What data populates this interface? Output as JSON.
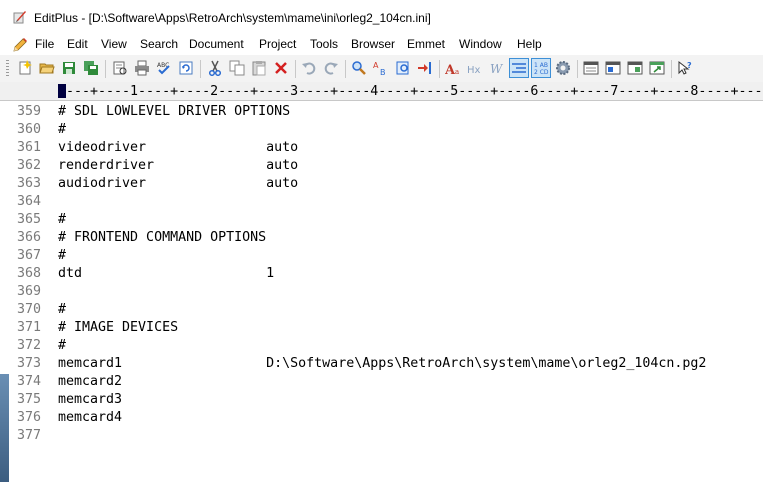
{
  "window": {
    "title": "EditPlus - [D:\\Software\\Apps\\RetroArch\\system\\mame\\ini\\orleg2_104cn.ini]"
  },
  "menu": {
    "items": [
      "File",
      "Edit",
      "View",
      "Search",
      "Document",
      "Project",
      "Tools",
      "Browser",
      "Emmet",
      "Window",
      "Help"
    ]
  },
  "toolbar": {
    "buttons": [
      {
        "icon": "new-file-icon"
      },
      {
        "icon": "open-folder-icon"
      },
      {
        "icon": "save-icon"
      },
      {
        "icon": "save-all-icon"
      },
      {
        "icon": "print-preview-icon"
      },
      {
        "icon": "print-icon"
      },
      {
        "icon": "spell-check-icon"
      },
      {
        "icon": "refresh-icon"
      },
      {
        "icon": "cut-icon"
      },
      {
        "icon": "copy-icon"
      },
      {
        "icon": "paste-icon"
      },
      {
        "icon": "delete-icon"
      },
      {
        "icon": "undo-icon"
      },
      {
        "icon": "redo-icon"
      },
      {
        "icon": "find-icon"
      },
      {
        "icon": "replace-icon"
      },
      {
        "icon": "find-in-files-icon"
      },
      {
        "icon": "goto-icon"
      },
      {
        "icon": "font-icon"
      },
      {
        "icon": "hex-icon"
      },
      {
        "icon": "word-wrap-icon"
      },
      {
        "icon": "line-numbers-icon"
      },
      {
        "icon": "ruler-icon"
      },
      {
        "icon": "settings-icon"
      },
      {
        "icon": "window-list-icon"
      },
      {
        "icon": "html-toolbar-icon"
      },
      {
        "icon": "cliptext-icon"
      },
      {
        "icon": "browser-icon"
      },
      {
        "icon": "help-icon"
      }
    ]
  },
  "ruler": {
    "text": "----+----1----+----2----+----3----+----4----+----5----+----6----+----7----+----8----+---"
  },
  "editor": {
    "lines": [
      {
        "num": "359",
        "text": "# SDL LOWLEVEL DRIVER OPTIONS"
      },
      {
        "num": "360",
        "text": "#"
      },
      {
        "num": "361",
        "text": "videodriver               auto"
      },
      {
        "num": "362",
        "text": "renderdriver              auto"
      },
      {
        "num": "363",
        "text": "audiodriver               auto"
      },
      {
        "num": "364",
        "text": ""
      },
      {
        "num": "365",
        "text": "#"
      },
      {
        "num": "366",
        "text": "# FRONTEND COMMAND OPTIONS"
      },
      {
        "num": "367",
        "text": "#"
      },
      {
        "num": "368",
        "text": "dtd                       1"
      },
      {
        "num": "369",
        "text": ""
      },
      {
        "num": "370",
        "text": "#"
      },
      {
        "num": "371",
        "text": "# IMAGE DEVICES"
      },
      {
        "num": "372",
        "text": "#"
      },
      {
        "num": "373",
        "text": "memcard1                  D:\\Software\\Apps\\RetroArch\\system\\mame\\orleg2_104cn.pg2"
      },
      {
        "num": "374",
        "text": "memcard2"
      },
      {
        "num": "375",
        "text": "memcard3"
      },
      {
        "num": "376",
        "text": "memcard4"
      },
      {
        "num": "377",
        "text": ""
      }
    ]
  }
}
